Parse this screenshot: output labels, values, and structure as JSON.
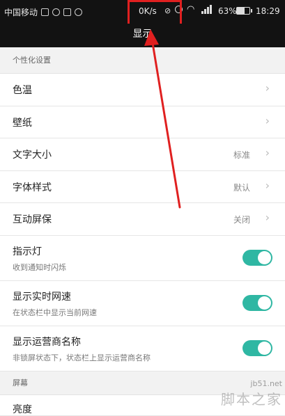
{
  "status_bar": {
    "carrier": "中国移动",
    "net_speed": "0K/s",
    "battery_percent": "63%",
    "battery_level": 0.63,
    "time": "18:29"
  },
  "title": "显示",
  "sections": {
    "personalize_header": "个性化设置",
    "screen_header": "屏幕"
  },
  "items": {
    "color_temp": "色温",
    "wallpaper": "壁纸",
    "text_size": {
      "label": "文字大小",
      "value": "标准"
    },
    "font_style": {
      "label": "字体样式",
      "value": "默认"
    },
    "screensaver": {
      "label": "互动屏保",
      "value": "关闭"
    },
    "indicator": {
      "label": "指示灯",
      "sub": "收到通知时闪烁",
      "enabled": true
    },
    "realtime_speed": {
      "label": "显示实时网速",
      "sub": "在状态栏中显示当前网速",
      "enabled": true
    },
    "carrier_name": {
      "label": "显示运营商名称",
      "sub": "非锁屏状态下，状态栏上显示运营商名称",
      "enabled": true
    },
    "brightness": "亮度"
  },
  "watermark": {
    "site": "jb51.net",
    "name": "脚本之家"
  },
  "colors": {
    "toggle_on": "#2fb7a3",
    "annotation": "#e02020"
  }
}
